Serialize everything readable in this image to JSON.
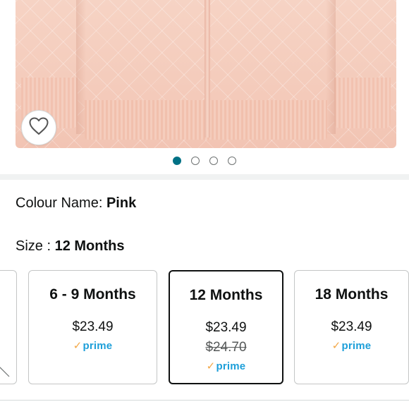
{
  "product": {
    "image_alt": "Pink quilted zip-up jacket",
    "wishlist_icon": "heart-outline-icon"
  },
  "carousel": {
    "dot_count": 4,
    "active_index": 0
  },
  "colour": {
    "label": "Colour Name:",
    "value": "Pink"
  },
  "size": {
    "label": "Size :",
    "value": "12 Months",
    "options": [
      {
        "title": "6 - 9 Months",
        "price": "$23.49",
        "old_price": "",
        "prime": "prime",
        "selected": false
      },
      {
        "title": "12 Months",
        "price": "$23.49",
        "old_price": "$24.70",
        "prime": "prime",
        "selected": true
      },
      {
        "title": "18 Months",
        "price": "$23.49",
        "old_price": "",
        "prime": "prime",
        "selected": false
      }
    ]
  },
  "colors": {
    "active_dot": "#007185",
    "prime_blue": "#1d9fd9",
    "prime_check": "#f3a847"
  }
}
